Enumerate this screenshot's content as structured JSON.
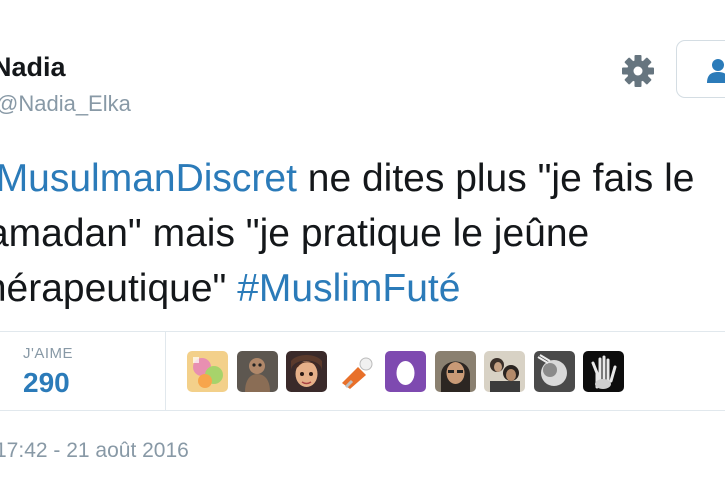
{
  "profile": {
    "display_name": "Nadia",
    "handle": "@Nadia_Elka"
  },
  "icons": {
    "settings": "gear-icon",
    "follow": "person-icon"
  },
  "tweet": {
    "line1_hashtag": "#MusulmanDiscret",
    "line1_text": " ne dites plus \"je fais le",
    "line2": "ramadan\" mais \"je pratique le jeûne",
    "line3_text": "thérapeutique\" ",
    "line3_hashtag": "#MuslimFuté"
  },
  "stats": {
    "likes_label": "J'AIME",
    "likes_count": "290"
  },
  "likers": [
    {
      "name": "liker-avatar-1"
    },
    {
      "name": "liker-avatar-2"
    },
    {
      "name": "liker-avatar-3"
    },
    {
      "name": "liker-avatar-4"
    },
    {
      "name": "liker-avatar-5"
    },
    {
      "name": "liker-avatar-6"
    },
    {
      "name": "liker-avatar-7"
    },
    {
      "name": "liker-avatar-8"
    },
    {
      "name": "liker-avatar-9"
    }
  ],
  "timestamp": "17:42 - 21 août 2016",
  "colors": {
    "link": "#2b7bb9",
    "muted": "#8899a6",
    "text": "#14171a",
    "border": "#e1e8ed"
  }
}
